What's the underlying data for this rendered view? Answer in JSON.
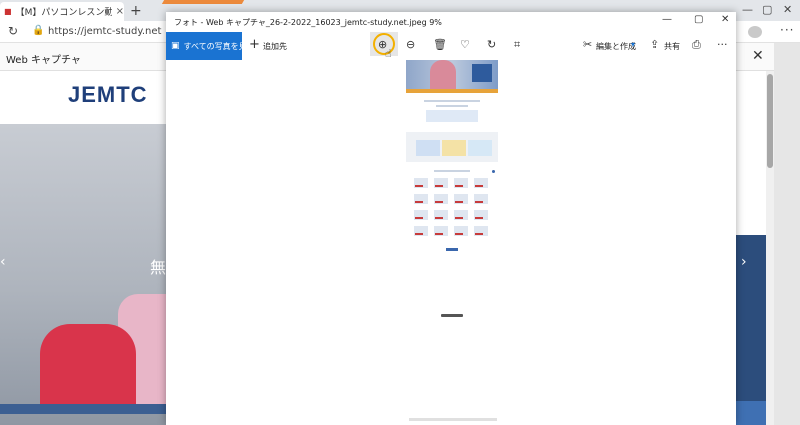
{
  "browser": {
    "tab_title": "【M】パソコンレスン動画ー もっ",
    "tab_close": "×",
    "new_tab": "+",
    "minimize": "—",
    "maximize": "▢",
    "close": "✕",
    "url": "https://jemtc-study.net",
    "more": "···",
    "web_capture": "Web キャプチャ",
    "web_capture_close": "✕"
  },
  "site": {
    "logo": "JEMTC",
    "hero_char": "無",
    "prev": "‹",
    "next": "›"
  },
  "photos": {
    "title": "フォト - Web キャプチャ_26-2-2022_16023_jemtc-study.net.jpeg   9%",
    "minimize": "—",
    "maximize": "▢",
    "close": "✕",
    "all_photos": "すべての写真を見る",
    "add": "追加先",
    "edit": "編集と作成",
    "share": "共有",
    "more": "···"
  },
  "colors": {
    "accent": "#1a73d2",
    "highlight": "#f3b000",
    "logo": "#1f3f7a"
  },
  "icons": {
    "zoom_in": "zoom-in-icon",
    "zoom_out": "zoom-out-icon",
    "delete": "trash-icon",
    "favorite": "heart-icon",
    "rotate": "rotate-icon",
    "crop": "crop-icon",
    "edit": "edit-icon",
    "share": "share-icon",
    "print": "printer-icon"
  }
}
